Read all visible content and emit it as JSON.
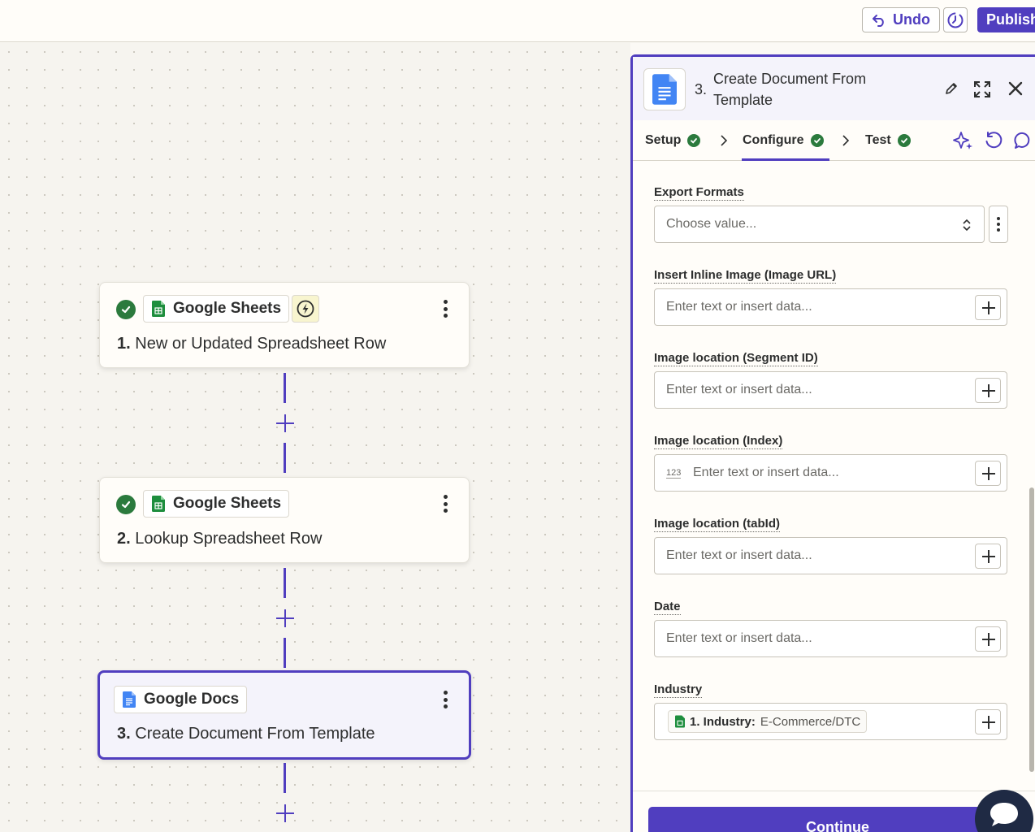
{
  "topbar": {
    "undo_label": "Undo",
    "publish_label": "Publish"
  },
  "steps": [
    {
      "number": "1.",
      "app": "Google Sheets",
      "title": "New or Updated Spreadsheet Row",
      "completed": true,
      "trigger": true
    },
    {
      "number": "2.",
      "app": "Google Sheets",
      "title": "Lookup Spreadsheet Row",
      "completed": true,
      "trigger": false
    },
    {
      "number": "3.",
      "app": "Google Docs",
      "title": "Create Document From Template",
      "selected": true
    }
  ],
  "panel": {
    "step_number": "3.",
    "title": "Create Document From Template",
    "tabs": [
      {
        "label": "Setup",
        "completed": true
      },
      {
        "label": "Configure",
        "completed": true,
        "active": true
      },
      {
        "label": "Test",
        "completed": true
      }
    ],
    "fields": [
      {
        "label": "Export Formats",
        "type": "select",
        "placeholder": "Choose value..."
      },
      {
        "label": "Insert Inline Image (Image URL)",
        "type": "text",
        "placeholder": "Enter text or insert data..."
      },
      {
        "label": "Image location (Segment ID)",
        "type": "text",
        "placeholder": "Enter text or insert data..."
      },
      {
        "label": "Image location (Index)",
        "type": "number",
        "prefix": "123",
        "placeholder": "Enter text or insert data..."
      },
      {
        "label": "Image location (tabId)",
        "type": "text",
        "placeholder": "Enter text or insert data..."
      },
      {
        "label": "Date",
        "type": "text",
        "placeholder": "Enter text or insert data..."
      },
      {
        "label": "Industry",
        "type": "mapped",
        "pill_label": "1. Industry:",
        "pill_value": "E-Commerce/DTC"
      }
    ],
    "continue_label": "Continue"
  },
  "colors": {
    "accent": "#503ebf",
    "success": "#2b7a3d",
    "sheets_green": "#1e8e3e",
    "docs_blue": "#4285f4",
    "trigger_bg": "#f8f5cf"
  }
}
